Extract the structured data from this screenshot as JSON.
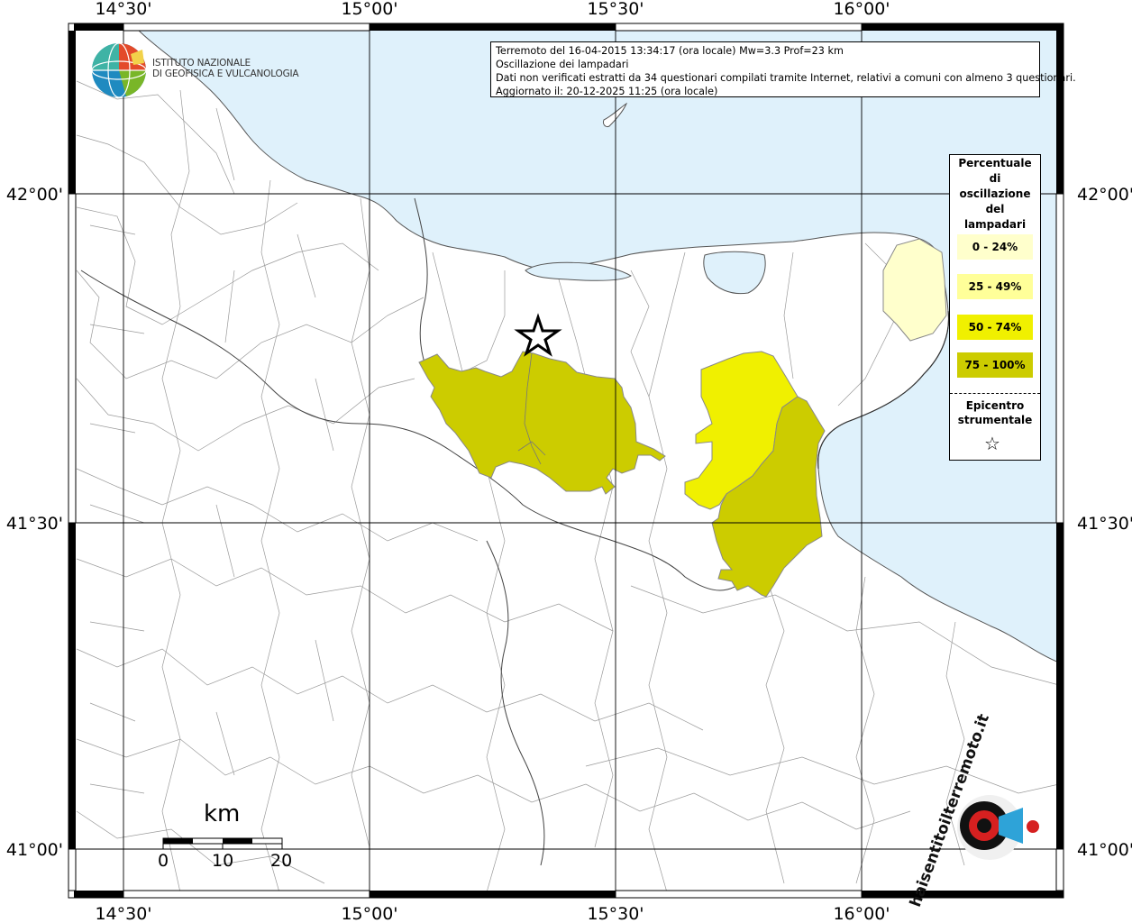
{
  "header": {
    "line1": "Terremoto del 16-04-2015 13:34:17 (ora locale) Mw=3.3 Prof=23 km",
    "line2": "Oscillazione dei lampadari",
    "line3": "Dati non verificati estratti da 34 questionari compilati tramite Internet, relativi a comuni con almeno 3 questionari.",
    "line4": "Aggiornato il: 20-12-2025 11:25 (ora locale)"
  },
  "ingv": {
    "line1": "ISTITUTO NAZIONALE",
    "line2": "DI GEOFISICA E VULCANOLOGIA",
    "icon": "ingv-globe-logo"
  },
  "coords": {
    "top": [
      "14°30'",
      "15°00'",
      "15°30'",
      "16°00'"
    ],
    "bottom": [
      "14°30'",
      "15°00'",
      "15°30'",
      "16°00'"
    ],
    "left": [
      "42°00'",
      "41°30'",
      "41°00'"
    ],
    "right": [
      "42°00'",
      "41°30'",
      "41°00'"
    ]
  },
  "legend": {
    "title_lines": [
      "Percentuale",
      "di",
      "oscillazione",
      "del",
      "lampadari"
    ],
    "items": [
      {
        "label": "0 - 24%",
        "color": "#ffffcc"
      },
      {
        "label": "25 - 49%",
        "color": "#ffff99"
      },
      {
        "label": "50 - 74%",
        "color": "#f0f000"
      },
      {
        "label": "75 - 100%",
        "color": "#cccc00"
      }
    ],
    "epicenter_lines": [
      "Epicentro",
      "strumentale"
    ],
    "epicenter_icon": "star-icon"
  },
  "scale": {
    "unit": "km",
    "ticks": [
      "0",
      "10",
      "20"
    ]
  },
  "watermark": {
    "text": "haisentitoilterremoto.it",
    "icon": "hst-speaker-logo"
  },
  "colors": {
    "sea": "#dff1fb",
    "land": "#ffffff",
    "class_0_24": "#ffffcc",
    "class_50_74": "#f0f000",
    "class_75_100": "#cccc00"
  }
}
